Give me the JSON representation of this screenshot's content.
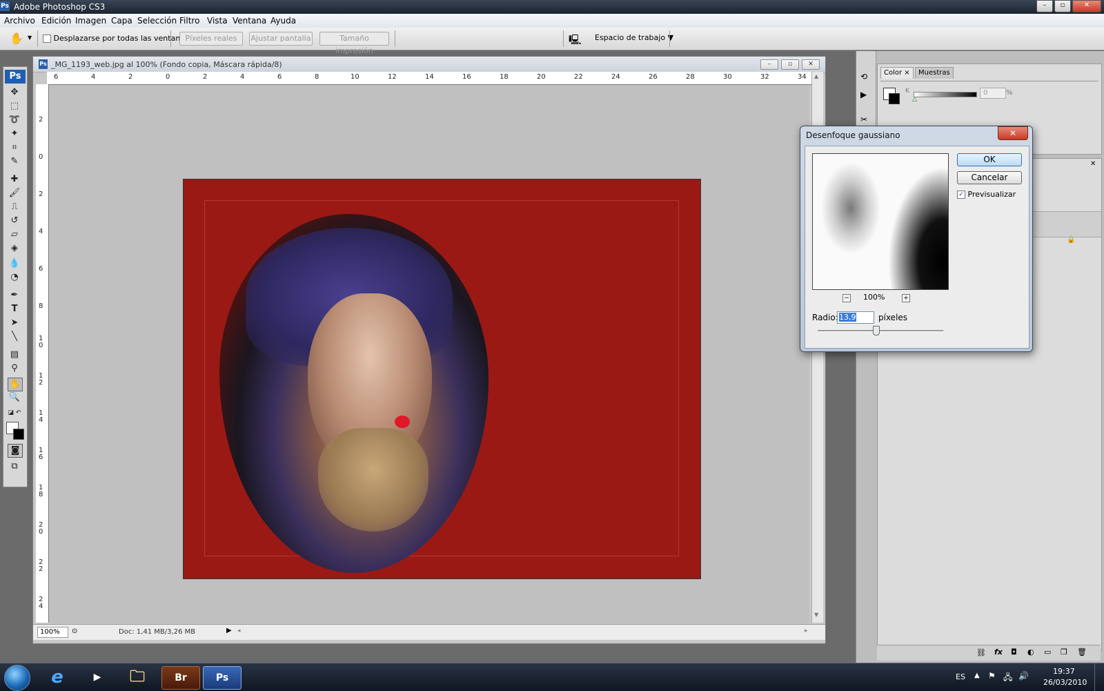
{
  "app": {
    "window_title": "Adobe Photoshop CS3",
    "badge": "Ps",
    "window_buttons": [
      "–",
      "▫",
      "✕"
    ]
  },
  "menu": {
    "items": [
      "Archivo",
      "Edición",
      "Imagen",
      "Capa",
      "Selección",
      "Filtro",
      "Vista",
      "Ventana",
      "Ayuda"
    ]
  },
  "options_bar": {
    "tool_icon": "hand-icon",
    "scroll_all_label": "Desplazarse por todas las ventanas",
    "scroll_all_checked": false,
    "actual_pixels_label": "Píxeles reales",
    "fit_screen_label": "Ajustar pantalla",
    "print_size_label": "Tamaño impresión",
    "workspace_label": "Espacio de trabajo"
  },
  "toolbox": {
    "logo": "Ps",
    "tools": [
      "move",
      "marquee",
      "lasso",
      "magic-wand",
      "crop",
      "slice",
      "healing-brush",
      "brush",
      "clone-stamp",
      "history-brush",
      "eraser",
      "paint-bucket",
      "blur",
      "dodge",
      "pen",
      "type",
      "path-selection",
      "line",
      "notes",
      "eyedropper",
      "hand",
      "zoom"
    ],
    "selected_tool": "hand"
  },
  "document": {
    "title": "_MG_1193_web.jpg al 100% (Fondo copia, Máscara rápida/8)",
    "icon": "Ps",
    "ruler_top": [
      "6",
      "4",
      "2",
      "0",
      "2",
      "4",
      "6",
      "8",
      "10",
      "12",
      "14",
      "16",
      "18",
      "20",
      "22",
      "24",
      "26",
      "28",
      "30",
      "32",
      "34"
    ],
    "ruler_left": [
      "2",
      "0",
      "2",
      "4",
      "6",
      "8",
      "1\n0",
      "1\n2",
      "1\n4",
      "1\n6",
      "1\n8",
      "2\n0",
      "2\n2",
      "2\n4"
    ],
    "zoom": "100%",
    "doc_info": "Doc: 1,41 MB/3,26 MB",
    "background_color": "#9b1915"
  },
  "panels": {
    "color_tab": "Color",
    "swatches_tab": "Muestras",
    "k_label": "K",
    "k_value": "0",
    "k_unit": "%"
  },
  "dialog": {
    "title": "Desenfoque gaussiano",
    "ok_label": "OK",
    "cancel_label": "Cancelar",
    "preview_label": "Previsualizar",
    "preview_checked": true,
    "preview_zoom": "100%",
    "radius_label": "Radio:",
    "radius_value": "13,9",
    "radius_unit": "píxeles",
    "close_glyph": "✕"
  },
  "taskbar": {
    "apps": [
      "start",
      "internet-explorer",
      "media-player",
      "file-explorer",
      "Br",
      "Ps"
    ],
    "language": "ES",
    "time": "19:37",
    "date": "26/03/2010"
  }
}
